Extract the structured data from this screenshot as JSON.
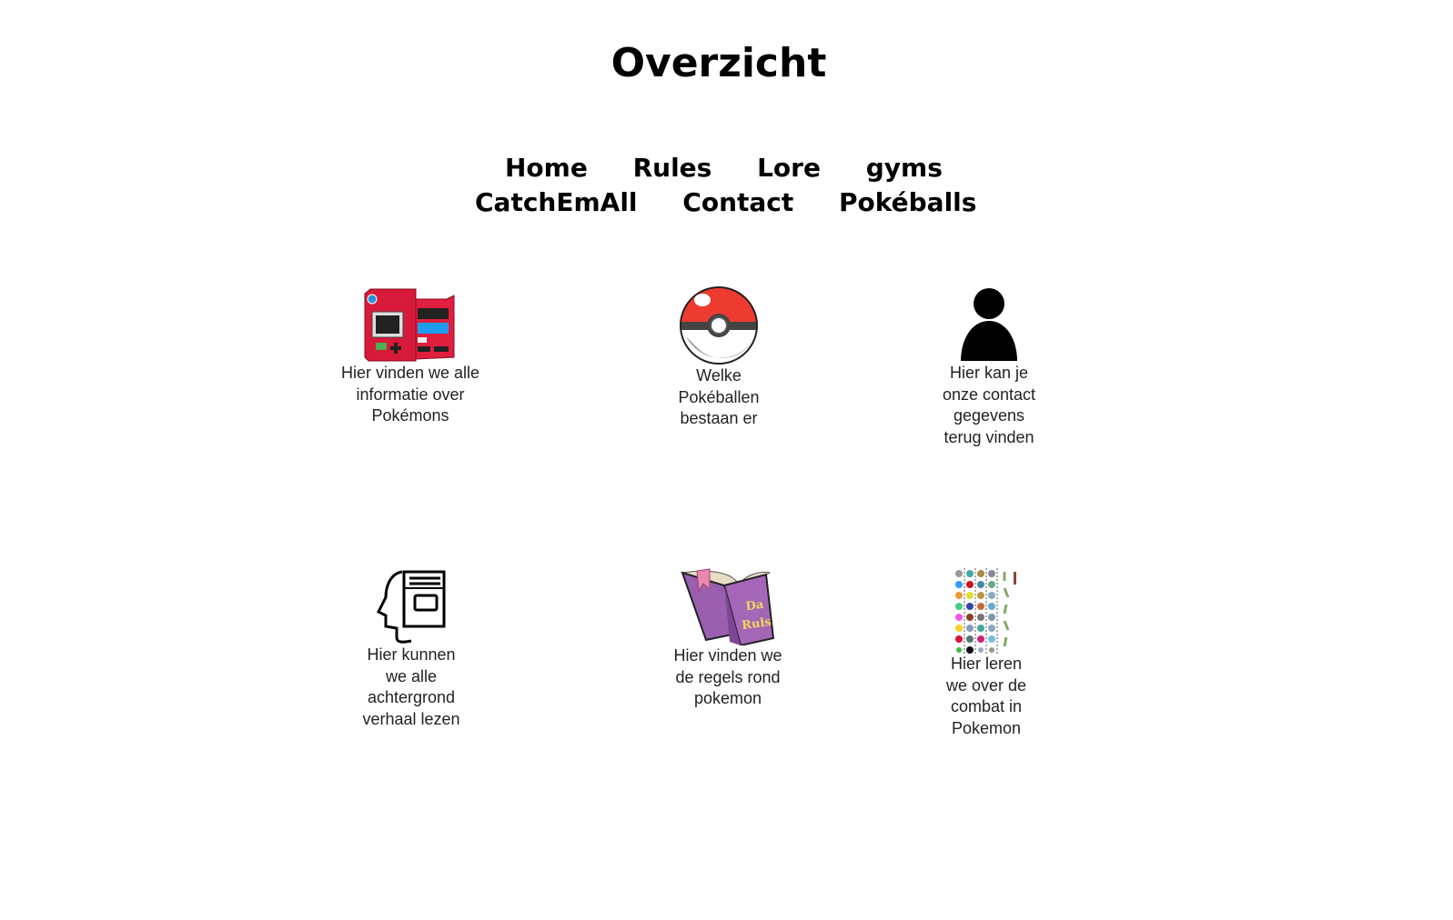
{
  "header": {
    "title": "Overzicht"
  },
  "nav": {
    "items": [
      "Home",
      "Rules",
      "Lore",
      "gyms",
      "CatchEmAll",
      "Contact",
      "Pokéballs"
    ]
  },
  "cards": [
    {
      "icon": "pokedex-icon",
      "text": "Hier vinden we alle informatie over Pokémons"
    },
    {
      "icon": "pokeball-icon",
      "text": "Welke Pokéballen bestaan er"
    },
    {
      "icon": "person-icon",
      "text": "Hier kan je onze contact gegevens terug vinden"
    },
    {
      "icon": "head-book-icon",
      "text": "Hier kunnen we alle achtergrond verhaal lezen"
    },
    {
      "icon": "rules-book-icon",
      "text": "Hier vinden we de regels rond pokemon",
      "book_label": "Da Ruls"
    },
    {
      "icon": "gym-badges-icon",
      "text": "Hier leren we over de combat in Pokemon"
    }
  ]
}
